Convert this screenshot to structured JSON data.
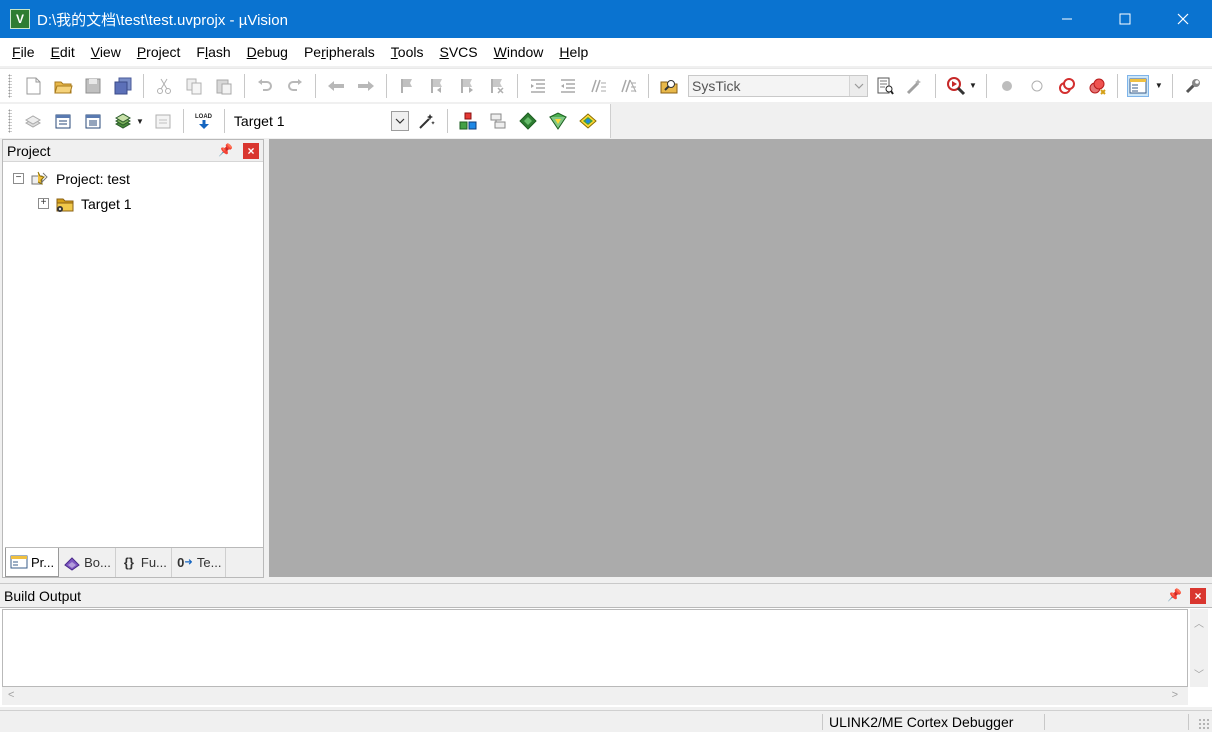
{
  "window": {
    "title": "D:\\我的文档\\test\\test.uvprojx - µVision",
    "app_icon_letter": "V"
  },
  "menu": [
    {
      "label": "File",
      "key": "F",
      "rest": "ile"
    },
    {
      "label": "Edit",
      "key": "E",
      "rest": "dit"
    },
    {
      "label": "View",
      "key": "V",
      "rest": "iew"
    },
    {
      "label": "Project",
      "key": "P",
      "rest": "roject"
    },
    {
      "label": "Flash",
      "pre": "F",
      "key": "l",
      "rest": "ash"
    },
    {
      "label": "Debug",
      "key": "D",
      "rest": "ebug"
    },
    {
      "label": "Peripherals",
      "pre": "Pe",
      "key": "r",
      "rest": "ipherals"
    },
    {
      "label": "Tools",
      "key": "T",
      "rest": "ools"
    },
    {
      "label": "SVCS",
      "key": "S",
      "rest": "VCS"
    },
    {
      "label": "Window",
      "key": "W",
      "rest": "indow"
    },
    {
      "label": "Help",
      "key": "H",
      "rest": "elp"
    }
  ],
  "toolbar": {
    "find_combo_value": "SysTick",
    "target_combo_value": "Target 1",
    "load_label": "LOAD"
  },
  "project_panel": {
    "title": "Project",
    "tree": {
      "root_label": "Project: test",
      "child_label": "Target 1"
    },
    "tabs": [
      {
        "label": "Pr..."
      },
      {
        "label": "Bo..."
      },
      {
        "label": "Fu...",
        "icon_text": "{}"
      },
      {
        "label": "Te...",
        "icon_text": "0"
      }
    ]
  },
  "build_output": {
    "title": "Build Output"
  },
  "status": {
    "debugger": "ULINK2/ME Cortex Debugger"
  },
  "colors": {
    "titlebar": "#0a73d0",
    "editor_bg": "#ababab",
    "close_red": "#d9362f"
  }
}
